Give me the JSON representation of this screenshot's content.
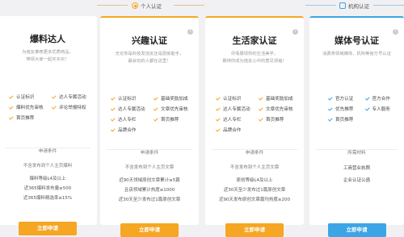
{
  "tabs": {
    "personal": "个人认证",
    "org": "机构认证"
  },
  "cards": [
    {
      "title": "爆料达人",
      "desc": [
        "为值友推荐更多优质商品，",
        "带领大家一起买买买！"
      ],
      "features": [
        "认证标识",
        "达人专属活动",
        "爆料优先审核",
        "评论举报特权",
        "首页推荐",
        ""
      ],
      "req_title": "申请条件",
      "reqs": [
        "不含发布到个人主页爆料",
        "爆料等级L4及以上",
        "近365爆料发布量≥500",
        "近365爆料精选率≥15%"
      ],
      "button": "立即申请"
    },
    {
      "title": "兴趣认证",
      "desc": [
        "无论你是科技发烧友还是厨房能手，",
        "最会玩的人都在这里！"
      ],
      "features": [
        "认证标识",
        "基础奖励加成",
        "达人专属活动",
        "文章优先审核",
        "达人专栏",
        "首页推荐",
        "品牌合作",
        ""
      ],
      "req_title": "申请条件",
      "reqs": [
        "不含发布到个人主页文章",
        "近90天领域原创文章累计≥5篇",
        "且该领域累计热度≥1000",
        "近30天至少发布过1篇原创文章"
      ],
      "button": "立即申请"
    },
    {
      "title": "生活家认证",
      "desc": [
        "尽情展现你的生活美学，",
        "期待你成为值友心中的意见领袖！"
      ],
      "features": [
        "认证标识",
        "基础奖励加成",
        "达人专属活动",
        "文章优先审核",
        "达人专栏",
        "首页推荐",
        "品牌合作",
        ""
      ],
      "req_title": "申请条件",
      "reqs": [
        "不含发布到个人主页文章",
        "原创等级L4及以上",
        "近30天至少发布过1篇原创文章",
        "近90天发布原创文章篇均热度≥200"
      ],
      "button": "立即申请"
    },
    {
      "title": "媒体号认证",
      "desc": [
        "消费类领域媒体、机构等官方号认证",
        ""
      ],
      "features": [
        "官方认证",
        "官方合作",
        "优先推荐",
        "专人服务",
        "首页推荐",
        ""
      ],
      "req_title": "所需材料",
      "reqs": [
        "工商营业执照",
        "企业认证公函"
      ],
      "button": "立即申请"
    }
  ]
}
